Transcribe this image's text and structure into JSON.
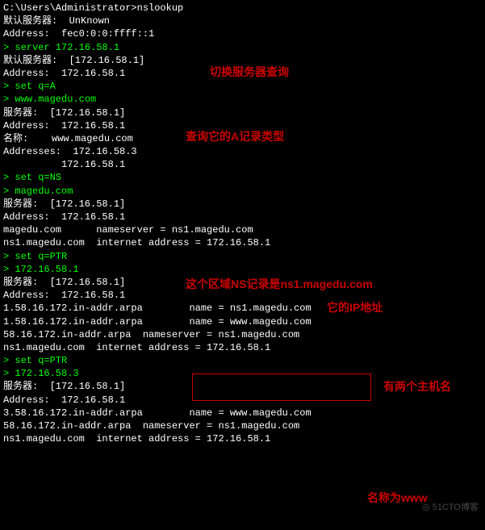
{
  "lines": {
    "l0": "C:\\Users\\Administrator>nslookup",
    "l1": "默认服务器:  UnKnown",
    "l2": "Address:  fec0:0:0:ffff::1",
    "l3": "",
    "l4": "> server 172.16.58.1",
    "l5": "默认服务器:  [172.16.58.1]",
    "l6": "Address:  172.16.58.1",
    "l7": "",
    "l8": "> set q=A",
    "l9": "> www.magedu.com",
    "l10": "服务器:  [172.16.58.1]",
    "l11": "Address:  172.16.58.1",
    "l12": "",
    "l13": "名称:    www.magedu.com",
    "l14": "Addresses:  172.16.58.3",
    "l15": "          172.16.58.1",
    "l16": "",
    "l17": "> set q=NS",
    "l18": "> magedu.com",
    "l19": "服务器:  [172.16.58.1]",
    "l20": "Address:  172.16.58.1",
    "l21": "",
    "l22": "magedu.com      nameserver = ns1.magedu.com",
    "l23": "ns1.magedu.com  internet address = 172.16.58.1",
    "l24": "> set q=PTR",
    "l25": "> 172.16.58.1",
    "l26": "服务器:  [172.16.58.1]",
    "l27": "Address:  172.16.58.1",
    "l28": "",
    "l29": "1.58.16.172.in-addr.arpa        name = ns1.magedu.com",
    "l30": "1.58.16.172.in-addr.arpa        name = www.magedu.com",
    "l31": "58.16.172.in-addr.arpa  nameserver = ns1.magedu.com",
    "l32": "ns1.magedu.com  internet address = 172.16.58.1",
    "l33": "> set q=PTR",
    "l34": "> 172.16.58.3",
    "l35": "服务器:  [172.16.58.1]",
    "l36": "Address:  172.16.58.1",
    "l37": "",
    "l38": "3.58.16.172.in-addr.arpa        name = www.magedu.com",
    "l39": "58.16.172.in-addr.arpa  nameserver = ns1.magedu.com",
    "l40": "ns1.magedu.com  internet address = 172.16.58.1"
  },
  "annotations": {
    "a1": "切换服务器查询",
    "a2": "查询它的A记录类型",
    "a3_prefix": "这个区域NS记录是",
    "a3_suffix": "ns1.magedu.com",
    "a4": "它的IP地址",
    "a5": "有两个主机名",
    "a6_prefix": "名称为",
    "a6_suffix": "www"
  },
  "watermark": "51CTO博客"
}
